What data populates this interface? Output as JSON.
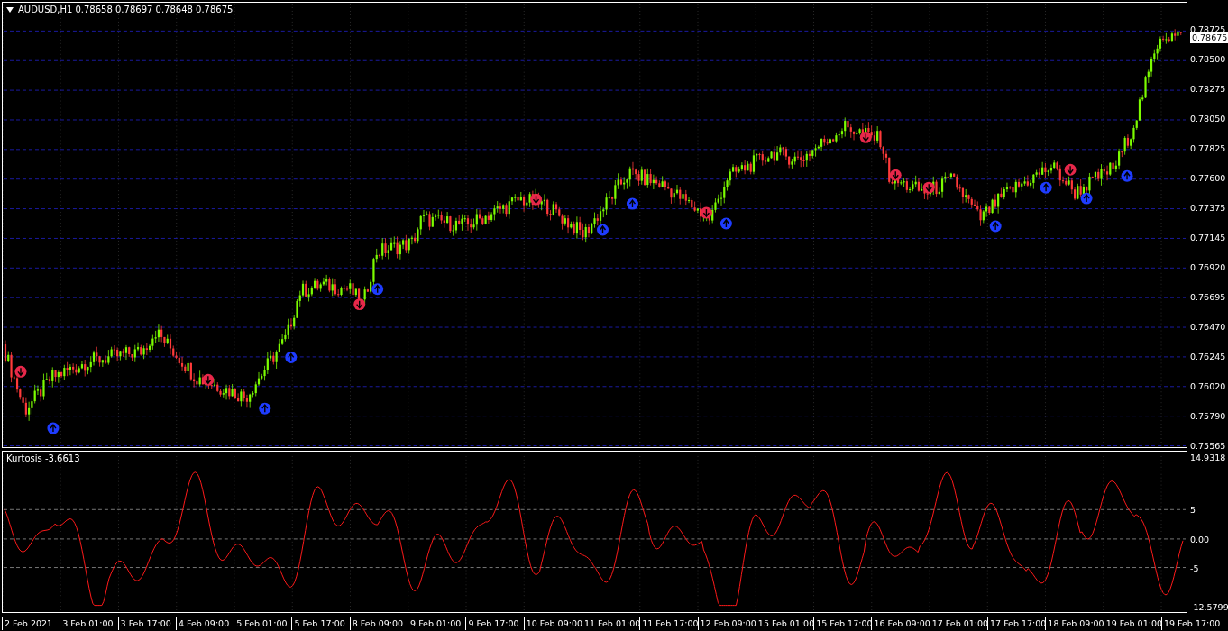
{
  "chart": {
    "title": "AUDUSD,H1  0.78658 0.78697 0.78648 0.78675",
    "price_ticks": [
      "0.78725",
      "0.78500",
      "0.78275",
      "0.78050",
      "0.77825",
      "0.77600",
      "0.77375",
      "0.77145",
      "0.76920",
      "0.76695",
      "0.76470",
      "0.76245",
      "0.76020",
      "0.75790",
      "0.75565"
    ],
    "current_price": "0.78675"
  },
  "indicator": {
    "label": "Kurtosis -3.6613",
    "axis_ticks": [
      "14.9318",
      "5",
      "0.00",
      "-5",
      "-12.5799"
    ]
  },
  "time_axis": {
    "labels": [
      "2 Feb 2021",
      "3 Feb 01:00",
      "3 Feb 17:00",
      "4 Feb 09:00",
      "5 Feb 01:00",
      "5 Feb 17:00",
      "8 Feb 09:00",
      "9 Feb 01:00",
      "9 Feb 17:00",
      "10 Feb 09:00",
      "11 Feb 01:00",
      "11 Feb 17:00",
      "12 Feb 09:00",
      "15 Feb 01:00",
      "15 Feb 17:00",
      "16 Feb 09:00",
      "17 Feb 01:00",
      "17 Feb 17:00",
      "18 Feb 09:00",
      "19 Feb 01:00",
      "19 Feb 17:00"
    ]
  }
}
